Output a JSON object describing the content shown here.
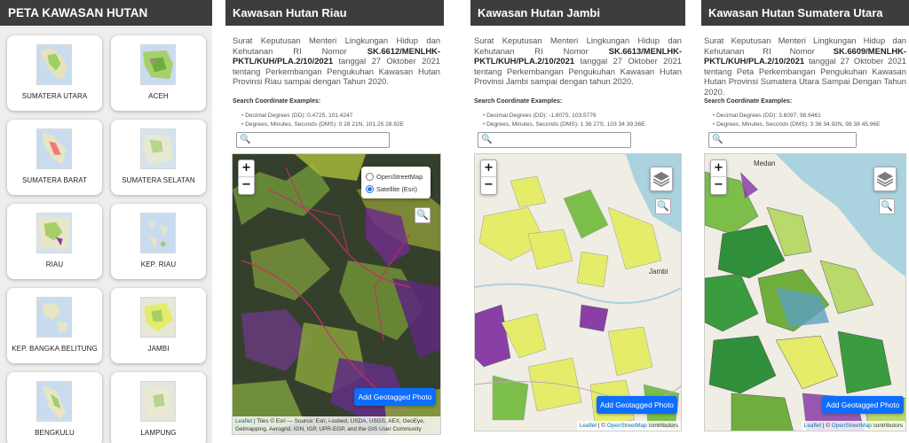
{
  "panel_list": {
    "title": "PETA KAWASAN HUTAN",
    "provinces": [
      {
        "label": "SUMATERA UTARA"
      },
      {
        "label": "ACEH"
      },
      {
        "label": "SUMATERA BARAT"
      },
      {
        "label": "SUMATERA SELATAN"
      },
      {
        "label": "RIAU"
      },
      {
        "label": "KEP. RIAU"
      },
      {
        "label": "KEP. BANGKA BELITUNG"
      },
      {
        "label": "JAMBI"
      },
      {
        "label": "BENGKULU"
      },
      {
        "label": "LAMPUNG"
      }
    ]
  },
  "search_examples": {
    "title": "Search Coordinate Examples:"
  },
  "panel_riau": {
    "title": "Kawasan Hutan Riau",
    "desc_pre": "Surat Keputusan Menteri Lingkungan Hidup dan Kehutanan RI Nomor ",
    "desc_bold": "SK.6612/MENLHK-PKTL/KUH/PLA.2/10/2021",
    "desc_post": " tanggal 27 Oktober 2021 tentang Perkembangan Pengukuhan Kawasan Hutan Provinsi Riau sampai dengan Tahun 2020.",
    "dd": "Decimal Degrees (DD): 0.4725, 101.4247",
    "dms": "Degrees, Minutes, Seconds (DMS): 0 28 21N, 101.25 28.92E",
    "layer_osm": "OpenStreetMap",
    "layer_sat": "Satellite (Esri)",
    "attr_link": "Leaflet",
    "attr_text": " | Tiles © Esri — Source: Esri, i-cubed, USDA, USGS, AEX, GeoEye, Getmapping, Aerogrid, IGN, IGP, UPR-EGP, and the GIS User Community"
  },
  "panel_jambi": {
    "title": "Kawasan Hutan Jambi",
    "desc_pre": "Surat Keputusan Menteri Lingkungan Hidup dan Kehutanan RI Nomor ",
    "desc_bold": "SK.6613/MENLHK-PKTL/KUH/PLA.2/10/2021",
    "desc_post": " tanggal 27 Oktober 2021 tentang Perkembangan Pengukuhan Kawasan Hutan Provinsi Jambi sampai dengan tahun 2020.",
    "dd": "Decimal Degrees (DD): -1.6075, 103.5776",
    "dms": "Degrees, Minutes, Seconds (DMS): 1 36 27S, 103 34 39.36E",
    "attr_link": "Leaflet",
    "attr_mid": " | © ",
    "attr_link2": "OpenStreetMap",
    "attr_end": " contributors"
  },
  "panel_sumut": {
    "title": "Kawasan Hutan Sumatera Utara",
    "desc_pre": "Surat Keputusan Menteri Lingkungan Hidup dan Kehutanan RI Nomor ",
    "desc_bold": "SK.6609/MENLHK-PKTL/KUH/PLA.2/10/2021",
    "desc_post": " tanggal 27 Oktober 2021 tentang Peta Perkembangan Pengukuhan Kawasan Hutan Provinsi Sumatera Utara Sampai Dengan Tahun 2020.",
    "dd": "Decimal Degrees (DD): 3.6097, 98.6461",
    "dms": "Degrees, Minutes, Seconds (DMS): 3 36 34.92N, 98 38 45.96E",
    "attr_link": "Leaflet",
    "attr_mid": " | © ",
    "attr_link2": "OpenStreetMap",
    "attr_end": " contributors"
  },
  "map_labels": {
    "jambi_city": "Jambi",
    "sumut_city": "Medan"
  },
  "common": {
    "zoom_in": "+",
    "zoom_out": "−",
    "geotag_button": "Add Geotagged Photo",
    "search_glyph": "🔍",
    "layers_icon": "layers-icon"
  },
  "colors": {
    "topbar": "#3d3d3d",
    "button": "#0d6efd",
    "forest_yellow": "#e4ec6a",
    "forest_green": "#7bbf4a",
    "forest_purple": "#8a3fa6"
  }
}
